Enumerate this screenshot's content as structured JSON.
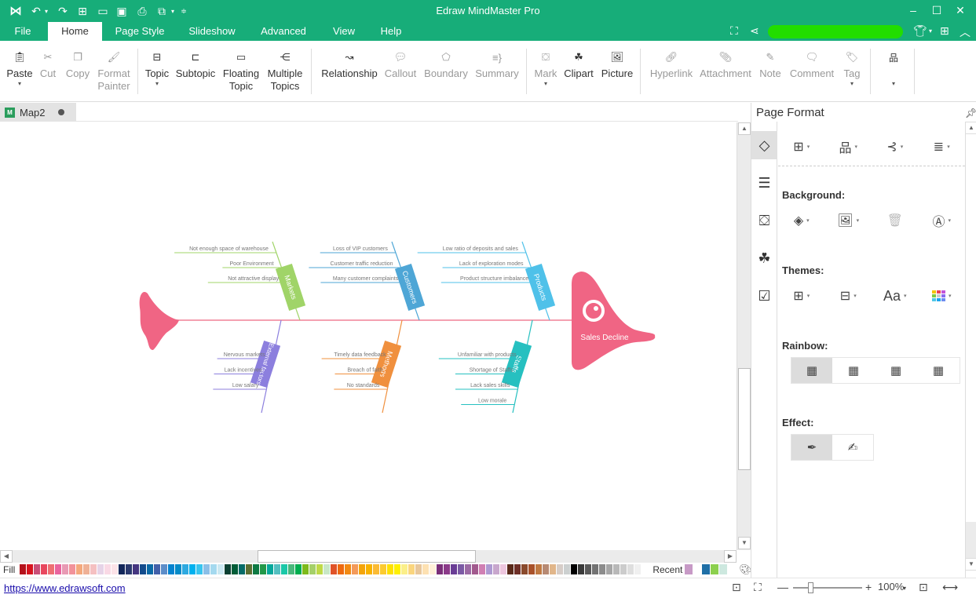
{
  "app": {
    "title": "Edraw MindMaster Pro"
  },
  "quick_access": [
    "logo-icon",
    "undo-icon",
    "dropdown-icon",
    "redo-icon",
    "new-icon",
    "open-icon",
    "save-icon",
    "print-icon",
    "export-icon",
    "customize-icon"
  ],
  "menu": {
    "tabs": [
      {
        "label": "File"
      },
      {
        "label": "Home",
        "active": true
      },
      {
        "label": "Page Style"
      },
      {
        "label": "Slideshow"
      },
      {
        "label": "Advanced"
      },
      {
        "label": "View"
      },
      {
        "label": "Help"
      }
    ]
  },
  "ribbon": {
    "buttons": [
      {
        "label": "Paste",
        "dropdown": true,
        "enabled": true,
        "icon": "paste-icon"
      },
      {
        "label": "Cut",
        "enabled": false,
        "icon": "cut-icon"
      },
      {
        "label": "Copy",
        "enabled": false,
        "icon": "copy-icon"
      },
      {
        "label": "Format Painter",
        "enabled": false,
        "icon": "format-painter-icon"
      },
      {
        "label": "Topic",
        "dropdown": true,
        "enabled": true,
        "icon": "topic-icon"
      },
      {
        "label": "Subtopic",
        "enabled": true,
        "icon": "subtopic-icon"
      },
      {
        "label": "Floating Topic",
        "enabled": true,
        "icon": "floating-topic-icon"
      },
      {
        "label": "Multiple Topics",
        "enabled": true,
        "icon": "multiple-topics-icon"
      },
      {
        "label": "Relationship",
        "enabled": true,
        "icon": "relationship-icon"
      },
      {
        "label": "Callout",
        "enabled": false,
        "icon": "callout-icon"
      },
      {
        "label": "Boundary",
        "enabled": false,
        "icon": "boundary-icon"
      },
      {
        "label": "Summary",
        "enabled": false,
        "icon": "summary-icon"
      },
      {
        "label": "Mark",
        "dropdown": true,
        "enabled": false,
        "icon": "mark-icon"
      },
      {
        "label": "Clipart",
        "enabled": true,
        "icon": "clipart-icon"
      },
      {
        "label": "Picture",
        "enabled": true,
        "icon": "picture-icon"
      },
      {
        "label": "Hyperlink",
        "enabled": false,
        "icon": "hyperlink-icon"
      },
      {
        "label": "Attachment",
        "enabled": false,
        "icon": "attachment-icon"
      },
      {
        "label": "Note",
        "enabled": false,
        "icon": "note-icon"
      },
      {
        "label": "Comment",
        "enabled": false,
        "icon": "comment-icon"
      },
      {
        "label": "Tag",
        "dropdown": true,
        "enabled": false,
        "icon": "tag-icon"
      },
      {
        "label": "",
        "dropdown": true,
        "enabled": true,
        "icon": "layout-icon"
      }
    ]
  },
  "document": {
    "tab": "Map2"
  },
  "fishbone": {
    "head": "Sales Decline",
    "colors": {
      "spine": "#f4a0b0",
      "head": "#f06584"
    },
    "categories": [
      {
        "name": "Markets",
        "color": "#a0d468",
        "side": "top",
        "causes": [
          "Not enough space of warehouse",
          "Poor Environment",
          "Not attractive display"
        ]
      },
      {
        "name": "Customers",
        "color": "#4ea6d6",
        "side": "top",
        "causes": [
          "Loss of VIP customers",
          "Customer traffic reduction",
          "Many customer complaints"
        ]
      },
      {
        "name": "Products",
        "color": "#4fc1e9",
        "side": "top",
        "causes": [
          "Low ratio of deposits and sales",
          "Lack of exploration modes",
          "Product structure imbalance"
        ]
      },
      {
        "name": "External factors",
        "color": "#8c7fde",
        "side": "bottom",
        "causes": [
          "Nervous markets",
          "Lack incentives",
          "Low salary"
        ]
      },
      {
        "name": "Methods",
        "color": "#f0903e",
        "side": "bottom",
        "causes": [
          "Timely data feedback",
          "Breach of faith",
          "No standards"
        ]
      },
      {
        "name": "Staffs",
        "color": "#26c0c0",
        "side": "bottom",
        "causes": [
          "Unfamiliar with products",
          "Shortage of Staffs",
          "Lack sales skills",
          "Low morale"
        ]
      }
    ]
  },
  "colorbar": {
    "label": "Fill",
    "recent_label": "Recent",
    "colors": [
      "#b5121b",
      "#d7141e",
      "#c94f78",
      "#e8475e",
      "#ee6f73",
      "#e9649e",
      "#e89ab4",
      "#f2929a",
      "#f4a97d",
      "#efb196",
      "#f5c0c1",
      "#e6d3e7",
      "#f9d9e5",
      "#fce3e8",
      "#13275a",
      "#2b3a6e",
      "#453680",
      "#134b8c",
      "#0b6aa6",
      "#4260a9",
      "#5c8dc8",
      "#0583cf",
      "#048bc8",
      "#2ea9e0",
      "#00b1ef",
      "#38c5ef",
      "#8bbfe7",
      "#a4d9ef",
      "#cbe8f1",
      "#0b4032",
      "#025d38",
      "#066b67",
      "#5c6f32",
      "#0e7a43",
      "#229849",
      "#07a89b",
      "#54bfc0",
      "#1bc8a8",
      "#4ab87c",
      "#00ae4f",
      "#7eba1b",
      "#a5d069",
      "#bfd947",
      "#c8e7c6",
      "#e05328",
      "#ee6a10",
      "#f28a13",
      "#f39a5a",
      "#f4a50a",
      "#f8b300",
      "#fbbb34",
      "#fccb2f",
      "#fee103",
      "#fef002",
      "#fbef89",
      "#fad57e",
      "#e8c79b",
      "#fde1b2",
      "#fff0d8",
      "#7a2f79",
      "#8b3a89",
      "#6a3d95",
      "#7b5aa4",
      "#9c6aa4",
      "#a25a8e",
      "#d07fb3",
      "#ae9ad2",
      "#c8a7cd",
      "#edc6de",
      "#5a2a1a",
      "#6e2f27",
      "#8a4a2c",
      "#a9522a",
      "#c07a43",
      "#b78a73",
      "#e1b68a",
      "#d6cdc8",
      "#ccd0d0",
      "#000000",
      "#3a3a3a",
      "#595959",
      "#737373",
      "#8c8c8c",
      "#a6a6a6",
      "#b8b8b8",
      "#cccccc",
      "#dedede",
      "#f0f0f0"
    ],
    "recent_colors": [
      "#c79ac6",
      "#ffffff",
      "#1f6fa6",
      "#8cd04e",
      "#cde8df"
    ]
  },
  "status": {
    "link": "https://www.edrawsoft.com",
    "zoom_level": "100%",
    "zoom_slider_fraction": 0.25
  },
  "sidebar": {
    "title": "Page Format",
    "tabs": [
      "page-format-icon",
      "outline-icon",
      "mark-icon",
      "clipart-icon",
      "task-icon"
    ],
    "sections": {
      "background": "Background:",
      "themes": "Themes:",
      "rainbow": "Rainbow:",
      "effect": "Effect:"
    }
  }
}
